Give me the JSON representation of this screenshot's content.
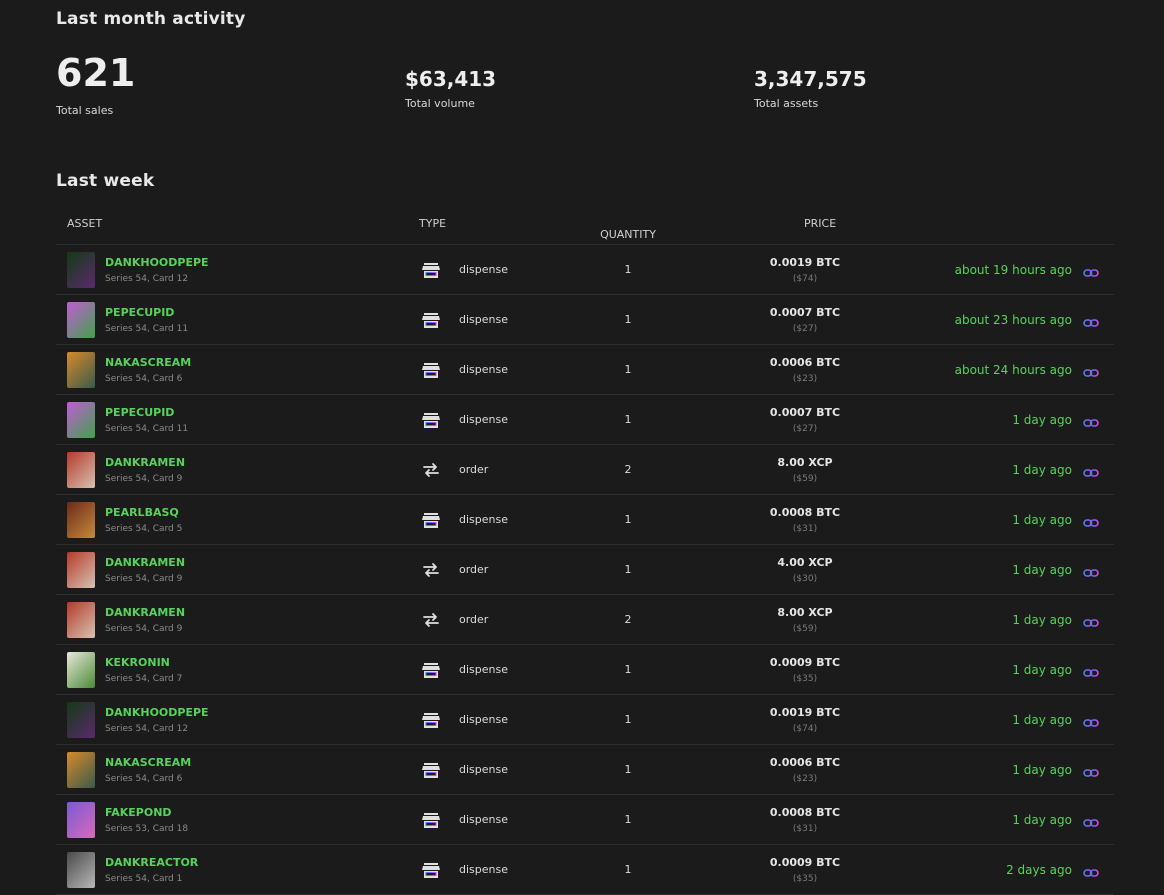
{
  "month": {
    "title": "Last month activity",
    "sales": {
      "value": "621",
      "label": "Total sales"
    },
    "volume": {
      "value": "$63,413",
      "label": "Total volume"
    },
    "assets": {
      "value": "3,347,575",
      "label": "Total assets"
    }
  },
  "week": {
    "title": "Last week",
    "headers": {
      "asset": "ASSET",
      "type": "TYPE",
      "quantity": "QUANTITY",
      "price": "PRICE"
    },
    "rows": [
      {
        "name": "DANKHOODPEPE",
        "series": "Series 54, Card 12",
        "type": "dispense",
        "qty": "1",
        "price": "0.0019 BTC",
        "usd": "($74)",
        "time": "about 19 hours ago",
        "thumb": [
          "#143a14",
          "#5a2a6e"
        ]
      },
      {
        "name": "PEPECUPID",
        "series": "Series 54, Card 11",
        "type": "dispense",
        "qty": "1",
        "price": "0.0007 BTC",
        "usd": "($27)",
        "time": "about 23 hours ago",
        "thumb": [
          "#c25bd6",
          "#3fa34a"
        ]
      },
      {
        "name": "NAKASCREAM",
        "series": "Series 54, Card 6",
        "type": "dispense",
        "qty": "1",
        "price": "0.0006 BTC",
        "usd": "($23)",
        "time": "about 24 hours ago",
        "thumb": [
          "#d88a2a",
          "#3a5a4a"
        ]
      },
      {
        "name": "PEPECUPID",
        "series": "Series 54, Card 11",
        "type": "dispense",
        "qty": "1",
        "price": "0.0007 BTC",
        "usd": "($27)",
        "time": "1 day ago",
        "thumb": [
          "#c25bd6",
          "#3fa34a"
        ]
      },
      {
        "name": "DANKRAMEN",
        "series": "Series 54, Card 9",
        "type": "order",
        "qty": "2",
        "price": "8.00 XCP",
        "usd": "($59)",
        "time": "1 day ago",
        "thumb": [
          "#b53a2a",
          "#d7c2b0"
        ]
      },
      {
        "name": "PEARLBASQ",
        "series": "Series 54, Card 5",
        "type": "dispense",
        "qty": "1",
        "price": "0.0008 BTC",
        "usd": "($31)",
        "time": "1 day ago",
        "thumb": [
          "#6a2a1a",
          "#c88a3a"
        ]
      },
      {
        "name": "DANKRAMEN",
        "series": "Series 54, Card 9",
        "type": "order",
        "qty": "1",
        "price": "4.00 XCP",
        "usd": "($30)",
        "time": "1 day ago",
        "thumb": [
          "#b53a2a",
          "#d7c2b0"
        ]
      },
      {
        "name": "DANKRAMEN",
        "series": "Series 54, Card 9",
        "type": "order",
        "qty": "2",
        "price": "8.00 XCP",
        "usd": "($59)",
        "time": "1 day ago",
        "thumb": [
          "#b53a2a",
          "#d7c2b0"
        ]
      },
      {
        "name": "KEKRONIN",
        "series": "Series 54, Card 7",
        "type": "dispense",
        "qty": "1",
        "price": "0.0009 BTC",
        "usd": "($35)",
        "time": "1 day ago",
        "thumb": [
          "#e8e8d8",
          "#4a8a3a"
        ]
      },
      {
        "name": "DANKHOODPEPE",
        "series": "Series 54, Card 12",
        "type": "dispense",
        "qty": "1",
        "price": "0.0019 BTC",
        "usd": "($74)",
        "time": "1 day ago",
        "thumb": [
          "#143a14",
          "#5a2a6e"
        ]
      },
      {
        "name": "NAKASCREAM",
        "series": "Series 54, Card 6",
        "type": "dispense",
        "qty": "1",
        "price": "0.0006 BTC",
        "usd": "($23)",
        "time": "1 day ago",
        "thumb": [
          "#d88a2a",
          "#3a5a4a"
        ]
      },
      {
        "name": "FAKEPOND",
        "series": "Series 53, Card 18",
        "type": "dispense",
        "qty": "1",
        "price": "0.0008 BTC",
        "usd": "($31)",
        "time": "1 day ago",
        "thumb": [
          "#7a5ad8",
          "#d86ab8"
        ]
      },
      {
        "name": "DANKREACTOR",
        "series": "Series 54, Card 1",
        "type": "dispense",
        "qty": "1",
        "price": "0.0009 BTC",
        "usd": "($35)",
        "time": "2 days ago",
        "thumb": [
          "#4a4a4a",
          "#b8b8b8"
        ]
      }
    ]
  }
}
